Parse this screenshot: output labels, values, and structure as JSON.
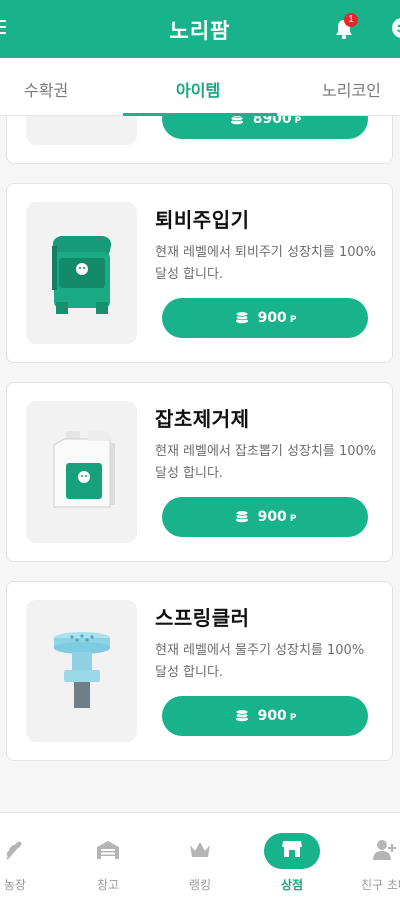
{
  "header": {
    "title": "노리팜",
    "notification_count": "1"
  },
  "tabs": [
    {
      "label": "수확권"
    },
    {
      "label": "아이템"
    },
    {
      "label": "노리코인"
    }
  ],
  "items": [
    {
      "name": "",
      "desc": "",
      "price": "8900",
      "unit": "P"
    },
    {
      "name": "퇴비주입기",
      "desc": "현재 레벨에서 퇴비주기 성장치를 100% 달성 합니다.",
      "price": "900",
      "unit": "P"
    },
    {
      "name": "잡초제거제",
      "desc": "현재 레벨에서 잡초뽑기 성장치를 100% 달성 합니다.",
      "price": "900",
      "unit": "P"
    },
    {
      "name": "스프링클러",
      "desc": "현재 레벨에서 물주기 성장치를 100% 달성 합니다.",
      "price": "900",
      "unit": "P"
    }
  ],
  "bottom_nav": [
    {
      "label": "농장",
      "icon": "farm-icon"
    },
    {
      "label": "창고",
      "icon": "warehouse-icon"
    },
    {
      "label": "랭킹",
      "icon": "crown-icon"
    },
    {
      "label": "상점",
      "icon": "store-icon"
    },
    {
      "label": "친구 초대",
      "icon": "add-friend-icon"
    }
  ],
  "colors": {
    "brand": "#18b38b",
    "badge": "#e8262b"
  }
}
